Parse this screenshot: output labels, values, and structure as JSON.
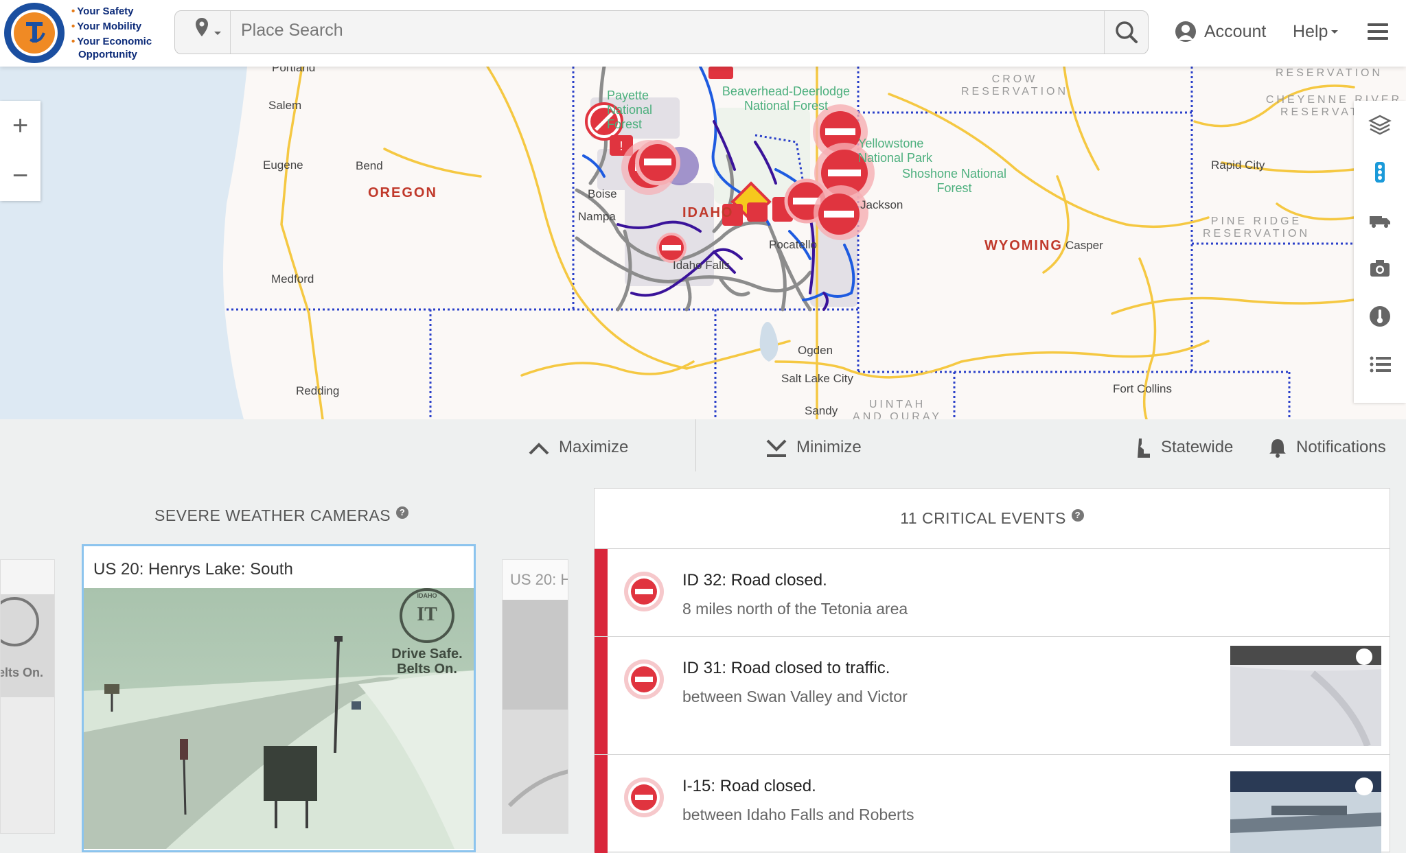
{
  "header": {
    "tagline": [
      "Your Safety",
      "Your Mobility",
      "Your Economic",
      "Opportunity"
    ],
    "search_placeholder": "Place Search",
    "account_label": "Account",
    "help_label": "Help"
  },
  "map": {
    "cities": [
      "Portland",
      "Salem",
      "Eugene",
      "Bend",
      "Medford",
      "Redding",
      "Ogden",
      "Salt Lake City",
      "Sandy",
      "Casper",
      "Rapid City",
      "Fort Collins",
      "Pocatello",
      "Idaho Falls",
      "Boise",
      "Nampa",
      "Jackson"
    ],
    "states": [
      "OREGON",
      "IDAHO",
      "WYOMING"
    ],
    "reservations": [
      "CROW RESERVATION",
      "CHEYENNE RIVER RESERVATION",
      "PINE RIDGE RESERVATION",
      "UINTAH AND OURAY",
      "RESERVATION"
    ],
    "forests": [
      "Payette National Forest",
      "Beaverhead-Deerlodge National Forest",
      "Yellowstone National Park",
      "Shoshone National Forest"
    ],
    "colors": {
      "interstate": "#f5c842",
      "closed": "#e0343f",
      "warning": "#f6c81d",
      "boundary": "#2a3fc9"
    }
  },
  "panel": {
    "maximize_label": "Maximize",
    "minimize_label": "Minimize",
    "statewide_label": "Statewide",
    "notifications_label": "Notifications"
  },
  "cameras": {
    "title": "SEVERE WEATHER CAMERAS",
    "main_caption": "US 20: Henrys Lake: South",
    "side_caption": "US 20: H",
    "overlay_top": "IDAHO",
    "overlay_line1": "Drive Safe.",
    "overlay_line2": "Belts On.",
    "side_overlay": "elts On."
  },
  "events": {
    "title": "11 CRITICAL EVENTS",
    "items": [
      {
        "headline": "ID 32: Road closed.",
        "detail": "8 miles north of the Tetonia area"
      },
      {
        "headline": "ID 31: Road closed to traffic.",
        "detail": "between Swan Valley and Victor"
      },
      {
        "headline": "I-15: Road closed.",
        "detail": "between Idaho Falls and Roberts"
      }
    ]
  }
}
